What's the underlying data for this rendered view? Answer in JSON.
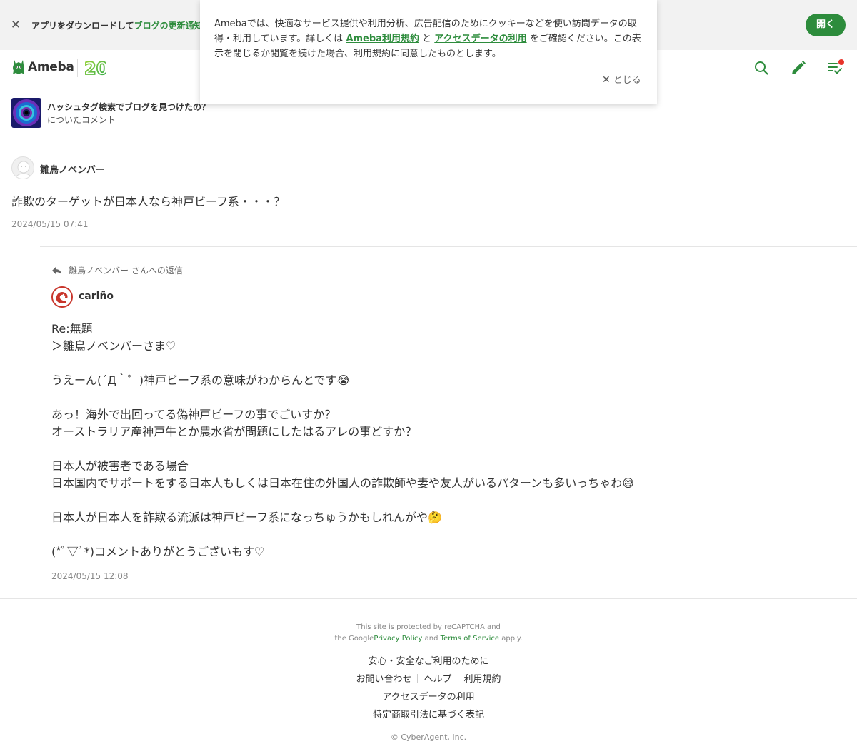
{
  "app_banner": {
    "close_icon": "close-icon",
    "text_prefix": "アプリをダウンロードして",
    "text_highlight": "ブログの更新通知",
    "open_label": "開く"
  },
  "header": {
    "logo_text": "Ameba",
    "anniversary_text": "20",
    "icons": [
      "search-icon",
      "pencil-icon",
      "feed-check-icon"
    ],
    "notification_color": "#e8332a"
  },
  "cookie_notice": {
    "text_1": "Amebaでは、快適なサービス提供や利用分析、広告配信のためにクッキーなどを使い訪問データの取得・利用しています。詳しくは",
    "link_terms": "Ameba利用規約",
    "text_and": "と",
    "link_access": "アクセスデータの利用",
    "text_2": "をご確認ください。この表示を閉じるか閲覧を続けた場合、利用規約に同意したものとします。",
    "close_label": "とじる"
  },
  "entry": {
    "title": "ハッシュタグ検索でブログを見つけたの？",
    "subtitle": "についたコメント"
  },
  "comment": {
    "author": "雛鳥ノベンバー",
    "body": "詐欺のターゲットが日本人なら神戸ビーフ系・・・？",
    "date": "2024/05/15 07:41"
  },
  "reply": {
    "reply_to": "雛鳥ノベンバー さんへの返信",
    "author": "cariño",
    "body": "Re:無題\n＞雛鳥ノベンバーさま♡\n\nうえーん(´Д｀゜)神戸ビーフ系の意味がわからんとです😭\n\nあっ！海外で出回ってる偽神戸ビーフの事でごいすか？\nオーストラリア産神戸牛とか農水省が問題にしたはるアレの事どすか？\n\n日本人が被害者である場合\n日本国内でサポートをする日本人もしくは日本在住の外国人の詐欺師や妻や友人がいるパターンも多いっちゃわ😅\n\n日本人が日本人を詐欺る流派は神戸ビーフ系になっちゅうかもしれんがや🤔\n\n(*ﾟ▽ﾟ*)コメントありがとうございもす♡",
    "date": "2024/05/15 12:08"
  },
  "footer": {
    "recaptcha_line1": "This site is protected by reCAPTCHA and",
    "recaptcha_the_google": "the Google",
    "privacy_policy": "Privacy Policy",
    "and": "and",
    "terms_of_service": "Terms of Service",
    "apply": "apply.",
    "safety": "安心・安全なご利用のために",
    "contact": "お問い合わせ",
    "help": "ヘルプ",
    "terms": "利用規約",
    "access_data": "アクセスデータの利用",
    "commercial_law": "特定商取引法に基づく表記",
    "copyright": "© CyberAgent, Inc."
  },
  "colors": {
    "accent": "#2d8c3c",
    "banner_bg": "#f2f2f2"
  }
}
